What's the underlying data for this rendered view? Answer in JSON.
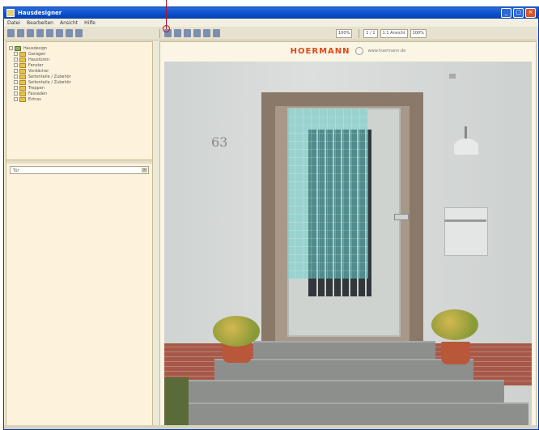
{
  "window": {
    "title": "Hausdesigner",
    "buttons": [
      "_",
      "□",
      "×"
    ]
  },
  "menu": [
    "Datei",
    "Bearbeiten",
    "Ansicht",
    "Hilfe"
  ],
  "toolbar": {
    "left_icons": [
      "select-icon",
      "info-icon",
      "tool-icon",
      "tool-icon",
      "tool-icon",
      "tool-icon",
      "tool-icon",
      "tool-icon"
    ],
    "right_icons": [
      "zoom-icon",
      "zoom-icon",
      "undo-icon",
      "redo-icon",
      "crop-icon",
      "rotate-icon"
    ],
    "zoom_field": "100%",
    "nav_fields": [
      "1 / 1",
      "1:1 Ansicht",
      "100%"
    ]
  },
  "tree": {
    "items": [
      {
        "label": "Hausdesign",
        "root": true
      },
      {
        "label": "Garagen"
      },
      {
        "label": "Haustüren"
      },
      {
        "label": "Fenster"
      },
      {
        "label": "Vordächer"
      },
      {
        "label": "Seitenteile / Zubehör"
      },
      {
        "label": "Seitenteile / Zubehör"
      },
      {
        "label": "Treppen"
      },
      {
        "label": "Fassaden"
      },
      {
        "label": "Extras"
      }
    ]
  },
  "search": {
    "value": "Tür",
    "button": "»"
  },
  "preview": {
    "brand": "HOERMANN",
    "brand_sub": "www.hoermann.de",
    "house_number": "63"
  }
}
